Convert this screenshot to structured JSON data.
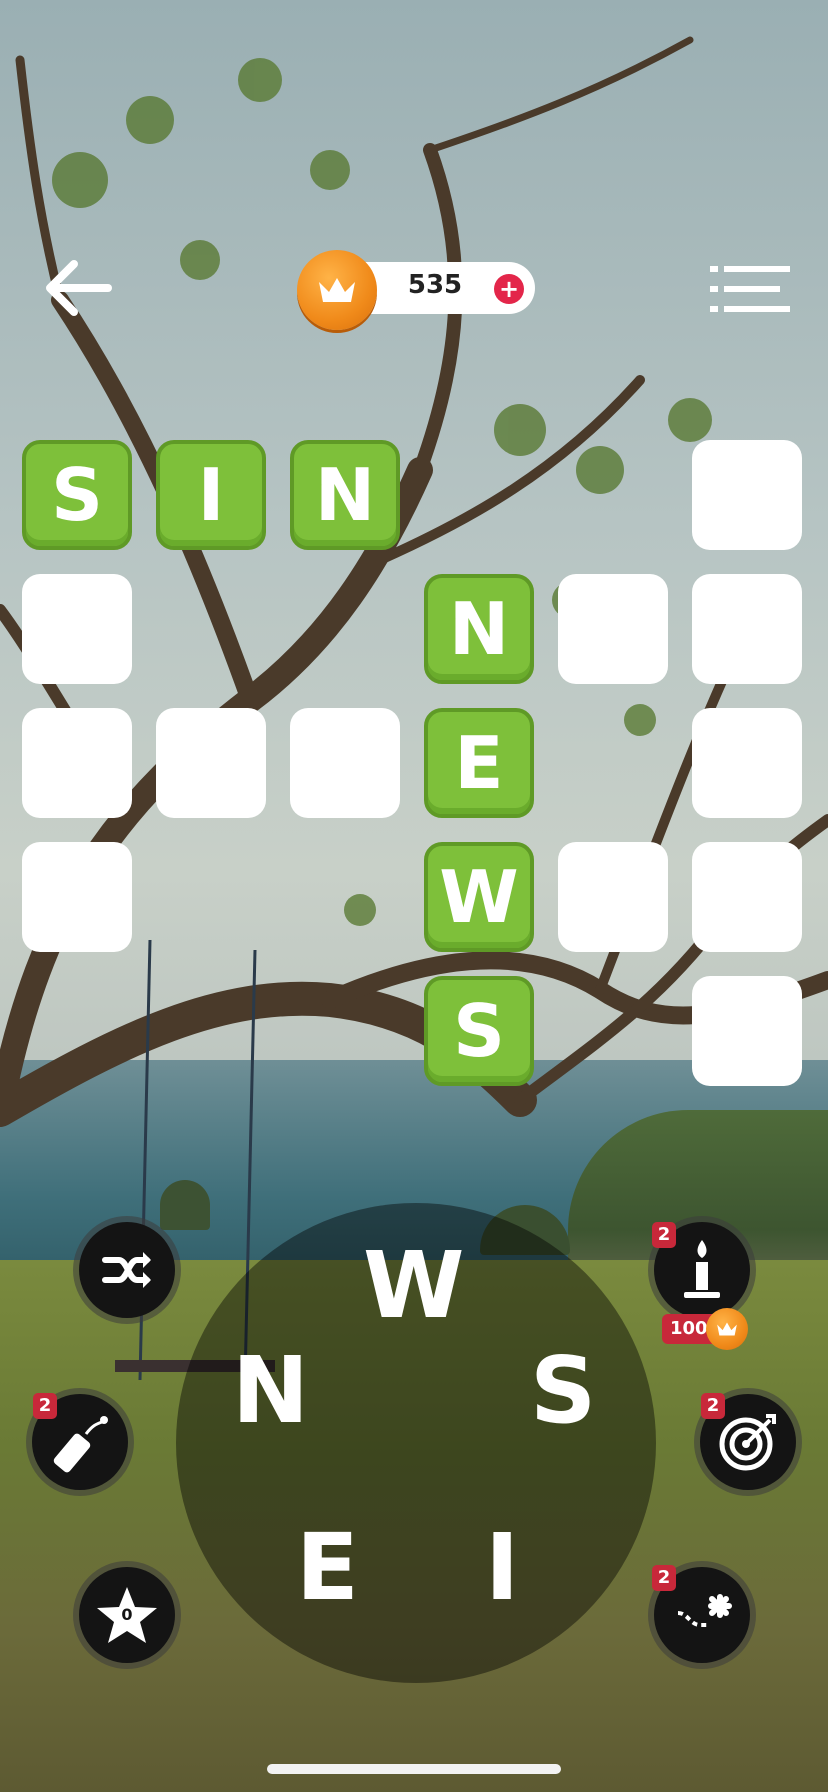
{
  "header": {
    "coins": "535",
    "coin_plus": "+"
  },
  "board": {
    "rows": [
      [
        {
          "c": "S",
          "filled": true
        },
        {
          "c": "I",
          "filled": true
        },
        {
          "c": "N",
          "filled": true
        },
        null,
        null,
        {
          "c": "",
          "filled": false
        }
      ],
      [
        {
          "c": "",
          "filled": false
        },
        null,
        null,
        {
          "c": "N",
          "filled": true
        },
        {
          "c": "",
          "filled": false
        },
        {
          "c": "",
          "filled": false
        }
      ],
      [
        {
          "c": "",
          "filled": false
        },
        {
          "c": "",
          "filled": false
        },
        {
          "c": "",
          "filled": false
        },
        {
          "c": "E",
          "filled": true
        },
        null,
        {
          "c": "",
          "filled": false
        }
      ],
      [
        {
          "c": "",
          "filled": false
        },
        null,
        null,
        {
          "c": "W",
          "filled": true
        },
        {
          "c": "",
          "filled": false
        },
        {
          "c": "",
          "filled": false
        }
      ],
      [
        null,
        null,
        null,
        {
          "c": "S",
          "filled": true
        },
        null,
        {
          "c": "",
          "filled": false
        }
      ]
    ]
  },
  "wheel": {
    "letters": [
      "W",
      "N",
      "S",
      "E",
      "I"
    ]
  },
  "powerups": {
    "shuffle": {
      "icon": "shuffle-icon"
    },
    "candle": {
      "icon": "candle-icon",
      "count": "2",
      "cost": "100"
    },
    "dynamite": {
      "icon": "dynamite-icon",
      "count": "2"
    },
    "target": {
      "icon": "target-icon",
      "count": "2"
    },
    "star": {
      "icon": "star-icon",
      "count": "0"
    },
    "path": {
      "icon": "path-plus-icon",
      "count": "2"
    }
  },
  "colors": {
    "tile_filled": "#7ec03a",
    "tile_empty": "#ffffff",
    "coin": "#f08a1a",
    "badge": "#c8283a"
  }
}
